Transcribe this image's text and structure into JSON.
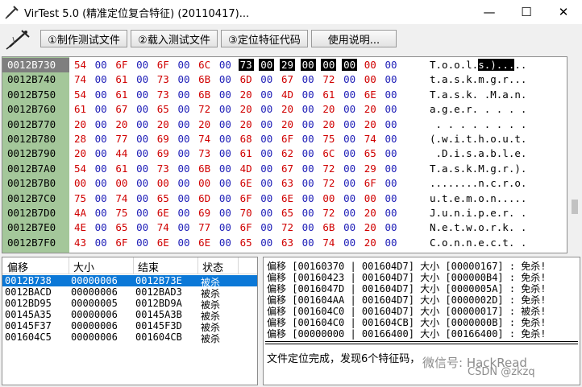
{
  "window": {
    "title": "VirTest 5.0 (精准定位复合特征) (20110417)...",
    "minimize": "—",
    "maximize": "☐",
    "close": "✕"
  },
  "toolbar": {
    "buttons": [
      "①制作测试文件",
      "②载入测试文件",
      "③定位特征代码",
      "使用说明..."
    ]
  },
  "hex_view": {
    "rows": [
      {
        "addr": "0012B730",
        "bytes": [
          "54",
          "00",
          "6F",
          "00",
          "6F",
          "00",
          "6C",
          "00",
          "73",
          "00",
          "29",
          "00",
          "00",
          "00",
          "00",
          "00"
        ],
        "ascii": "T.o.o.l.s.)....."
      },
      {
        "addr": "0012B740",
        "bytes": [
          "74",
          "00",
          "61",
          "00",
          "73",
          "00",
          "6B",
          "00",
          "6D",
          "00",
          "67",
          "00",
          "72",
          "00",
          "00",
          "00"
        ],
        "ascii": "t.a.s.k.m.g.r..."
      },
      {
        "addr": "0012B750",
        "bytes": [
          "54",
          "00",
          "61",
          "00",
          "73",
          "00",
          "6B",
          "00",
          "20",
          "00",
          "4D",
          "00",
          "61",
          "00",
          "6E",
          "00"
        ],
        "ascii": "T.a.s.k. .M.a.n."
      },
      {
        "addr": "0012B760",
        "bytes": [
          "61",
          "00",
          "67",
          "00",
          "65",
          "00",
          "72",
          "00",
          "20",
          "00",
          "20",
          "00",
          "20",
          "00",
          "20",
          "00"
        ],
        "ascii": "a.g.e.r. . . . ."
      },
      {
        "addr": "0012B770",
        "bytes": [
          "20",
          "00",
          "20",
          "00",
          "20",
          "00",
          "20",
          "00",
          "20",
          "00",
          "20",
          "00",
          "20",
          "00",
          "20",
          "00"
        ],
        "ascii": " . . . . . . . ."
      },
      {
        "addr": "0012B780",
        "bytes": [
          "28",
          "00",
          "77",
          "00",
          "69",
          "00",
          "74",
          "00",
          "68",
          "00",
          "6F",
          "00",
          "75",
          "00",
          "74",
          "00"
        ],
        "ascii": "(.w.i.t.h.o.u.t."
      },
      {
        "addr": "0012B790",
        "bytes": [
          "20",
          "00",
          "44",
          "00",
          "69",
          "00",
          "73",
          "00",
          "61",
          "00",
          "62",
          "00",
          "6C",
          "00",
          "65",
          "00"
        ],
        "ascii": " .D.i.s.a.b.l.e."
      },
      {
        "addr": "0012B7A0",
        "bytes": [
          "54",
          "00",
          "61",
          "00",
          "73",
          "00",
          "6B",
          "00",
          "4D",
          "00",
          "67",
          "00",
          "72",
          "00",
          "29",
          "00"
        ],
        "ascii": "T.a.s.k.M.g.r.)."
      },
      {
        "addr": "0012B7B0",
        "bytes": [
          "00",
          "00",
          "00",
          "00",
          "00",
          "00",
          "00",
          "00",
          "6E",
          "00",
          "63",
          "00",
          "72",
          "00",
          "6F",
          "00"
        ],
        "ascii": "........n.c.r.o."
      },
      {
        "addr": "0012B7C0",
        "bytes": [
          "75",
          "00",
          "74",
          "00",
          "65",
          "00",
          "6D",
          "00",
          "6F",
          "00",
          "6E",
          "00",
          "00",
          "00",
          "00",
          "00"
        ],
        "ascii": "u.t.e.m.o.n....."
      },
      {
        "addr": "0012B7D0",
        "bytes": [
          "4A",
          "00",
          "75",
          "00",
          "6E",
          "00",
          "69",
          "00",
          "70",
          "00",
          "65",
          "00",
          "72",
          "00",
          "20",
          "00"
        ],
        "ascii": "J.u.n.i.p.e.r. ."
      },
      {
        "addr": "0012B7E0",
        "bytes": [
          "4E",
          "00",
          "65",
          "00",
          "74",
          "00",
          "77",
          "00",
          "6F",
          "00",
          "72",
          "00",
          "6B",
          "00",
          "20",
          "00"
        ],
        "ascii": "N.e.t.w.o.r.k. ."
      },
      {
        "addr": "0012B7F0",
        "bytes": [
          "43",
          "00",
          "6F",
          "00",
          "6E",
          "00",
          "6E",
          "00",
          "65",
          "00",
          "63",
          "00",
          "74",
          "00",
          "20",
          "00"
        ],
        "ascii": "C.o.n.n.e.c.t. ."
      }
    ]
  },
  "result_list": {
    "headers": [
      "偏移",
      "大小",
      "结束",
      "状态"
    ],
    "rows": [
      {
        "offset": "0012B738",
        "size": "00000006",
        "end": "0012B73E",
        "status": "被杀"
      },
      {
        "offset": "0012BACD",
        "size": "00000006",
        "end": "0012BAD3",
        "status": "被杀"
      },
      {
        "offset": "0012BD95",
        "size": "00000005",
        "end": "0012BD9A",
        "status": "被杀"
      },
      {
        "offset": "00145A35",
        "size": "00000006",
        "end": "00145A3B",
        "status": "被杀"
      },
      {
        "offset": "00145F37",
        "size": "00000006",
        "end": "00145F3D",
        "status": "被杀"
      },
      {
        "offset": "001604C5",
        "size": "00000006",
        "end": "001604CB",
        "status": "被杀"
      }
    ]
  },
  "log": {
    "lines": [
      "偏移 [00160370 | 001604D7] 大小 [00000167] : 免杀!",
      "偏移 [00160423 | 001604D7] 大小 [000000B4] : 免杀!",
      "偏移 [0016047D | 001604D7] 大小 [0000005A] : 免杀!",
      "偏移 [001604AA | 001604D7] 大小 [0000002D] : 免杀!",
      "偏移 [001604C0 | 001604D7] 大小 [00000017] : 被杀!",
      "偏移 [001604C0 | 001604CB] 大小 [0000000B] : 免杀!",
      "偏移 [00000000 | 00166400] 大小 [00166400] : 免杀!"
    ],
    "status": "文件定位完成，发现6个特征码，"
  },
  "watermark": {
    "line1": "微信号: HackRead",
    "line2": "CSDN @zkzq"
  }
}
